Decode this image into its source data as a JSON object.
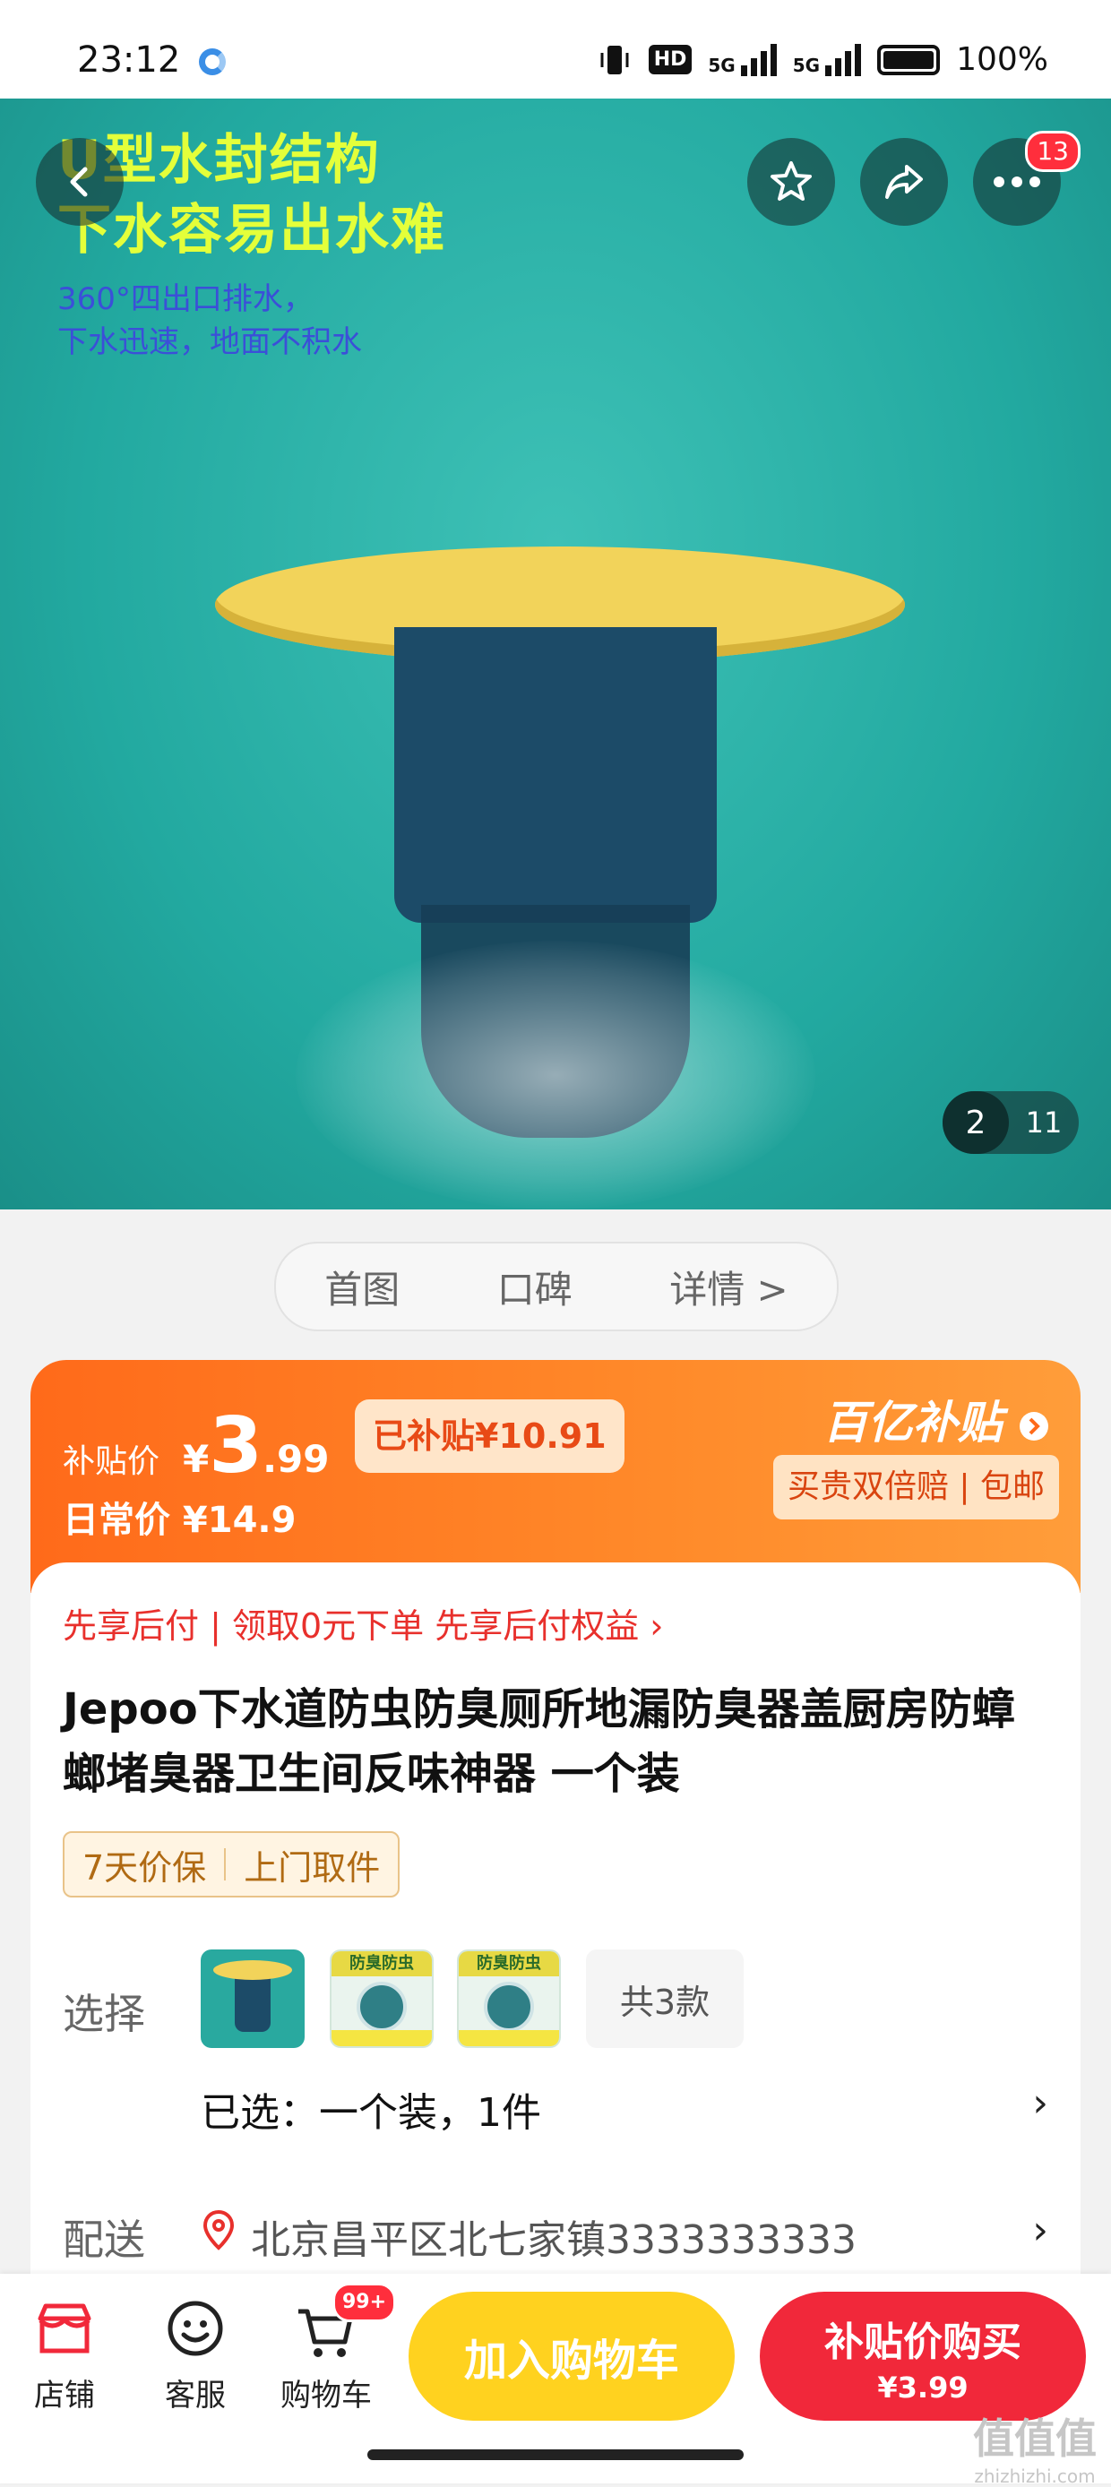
{
  "status_bar": {
    "time": "23:12",
    "hd_label": "HD",
    "net1": "5G",
    "net2": "5G",
    "battery": "100%"
  },
  "hero": {
    "headline_line1": "U型水封结构",
    "headline_line2": "下水容易出水难",
    "sub_line1": "360°四出口排水，",
    "sub_line2": "下水迅速，地面不积水",
    "more_badge": "13",
    "image_index": "2",
    "image_total": "11",
    "icons": {
      "back": "chevron-left-icon",
      "favorite": "star-icon",
      "share": "share-icon",
      "more": "more-dots-icon"
    }
  },
  "tabs": {
    "first": "首图",
    "second": "口碑",
    "third": "详情 >"
  },
  "price": {
    "label": "补贴价",
    "currency": "¥",
    "integer": "3",
    "decimal": ".99",
    "subsidy_tag": "已补贴¥10.91",
    "daily_price": "日常价 ¥14.9",
    "logo": "百亿补贴",
    "guarantee": "买贵双倍赔 | 包邮"
  },
  "product": {
    "promo": "先享后付 | 领取0元下单 先享后付权益 ›",
    "title": "Jepoo下水道防虫防臭厕所地漏防臭器盖厨房防蟑螂堵臭器卫生间反味神器 一个装",
    "chip1": "7天价保",
    "chip2": "上门取件",
    "select_label": "选择",
    "thumb_caption": "防臭防虫",
    "more_styles": "共3款",
    "selected": "已选：一个装，1件",
    "ship_label": "配送",
    "ship_address": "北京昌平区北七家镇3333333333",
    "chevron": "›"
  },
  "bottom_bar": {
    "shop": "店铺",
    "service": "客服",
    "cart": "购物车",
    "cart_badge": "99+",
    "add_to_cart": "加入购物车",
    "buy_line1": "补贴价购买",
    "buy_line2": "¥3.99"
  },
  "watermark": {
    "text": "值值值",
    "sub": "zhizhizhi.com"
  },
  "colors": {
    "accent_orange": "#ff6a1a",
    "buy_red": "#f1283a",
    "cart_yellow": "#ffd21f",
    "hero_teal": "#22a9a0"
  }
}
